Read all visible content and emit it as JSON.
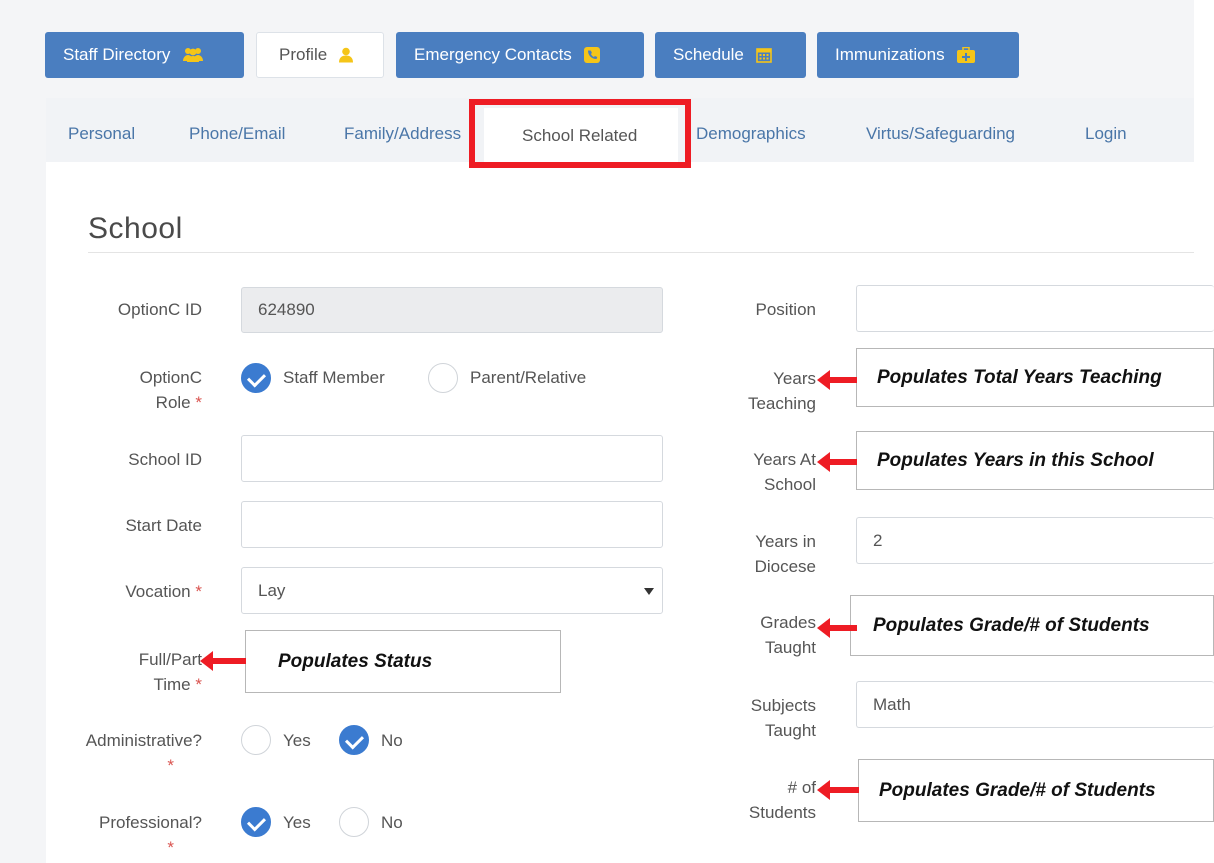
{
  "main_tabs": [
    {
      "label": "Staff Directory",
      "icon": "users-icon"
    },
    {
      "label": "Profile",
      "icon": "user-icon"
    },
    {
      "label": "Emergency Contacts",
      "icon": "phone-icon"
    },
    {
      "label": "Schedule",
      "icon": "calendar-icon"
    },
    {
      "label": "Immunizations",
      "icon": "medkit-icon"
    }
  ],
  "sub_tabs": [
    "Personal",
    "Phone/Email",
    "Family/Address",
    "School Related",
    "Demographics",
    "Virtus/Safeguarding",
    "Login"
  ],
  "section_title": "School",
  "left": {
    "optionc_id": {
      "label": "OptionC ID",
      "value": "624890"
    },
    "optionc_role": {
      "label_1": "OptionC",
      "label_2": "Role",
      "required": "*",
      "option_1": "Staff Member",
      "option_2": "Parent/Relative"
    },
    "school_id": {
      "label": "School ID",
      "value": ""
    },
    "start_date": {
      "label": "Start Date",
      "value": ""
    },
    "vocation": {
      "label": "Vocation",
      "required": "*",
      "value": "Lay"
    },
    "full_part": {
      "label_1": "Full/Part",
      "label_2": "Time",
      "required": "*"
    },
    "administrative": {
      "label": "Administrative?",
      "required": "*",
      "yes": "Yes",
      "no": "No"
    },
    "professional": {
      "label": "Professional?",
      "required": "*",
      "yes": "Yes",
      "no": "No"
    }
  },
  "right": {
    "position": {
      "label": "Position",
      "value": ""
    },
    "years_teaching": {
      "label_1": "Years",
      "label_2": "Teaching"
    },
    "years_at_school": {
      "label_1": "Years At",
      "label_2": "School"
    },
    "years_in_diocese": {
      "label_1": "Years in",
      "label_2": "Diocese",
      "value": "2"
    },
    "grades_taught": {
      "label_1": "Grades",
      "label_2": "Taught"
    },
    "subjects_taught": {
      "label_1": "Subjects",
      "label_2": "Taught",
      "value": "Math"
    },
    "num_students": {
      "label_1": "# of",
      "label_2": "Students"
    }
  },
  "callouts": {
    "status": "Populates Status",
    "years_teaching": "Populates Total Years Teaching",
    "years_school": "Populates Years in this School",
    "grades": "Populates Grade/# of Students",
    "students": "Populates Grade/# of Students"
  },
  "colors": {
    "tab_blue": "#4a7ec0",
    "radio_blue": "#3b7bd0",
    "annotation_red": "#ee1c24",
    "icon_yellow": "#f5c518"
  }
}
